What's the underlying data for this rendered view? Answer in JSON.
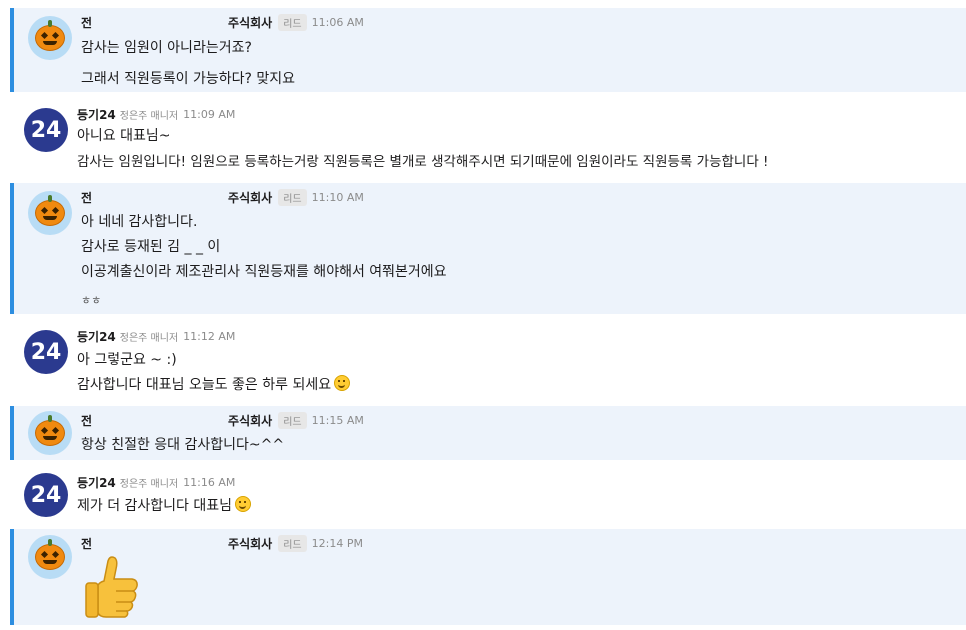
{
  "colors": {
    "highlight_bg": "#edf3fb",
    "highlight_border": "#2d8ee0",
    "brand_avatar": "#2b3a8f"
  },
  "messages": [
    {
      "sender": "전",
      "company": "주식회사",
      "tag": "리드",
      "time": "11:06 AM",
      "avatar": "pumpkin-icon",
      "lines": [
        "감사는 임원이 아니라는거죠?",
        "그래서 직원등록이 가능하다? 맞지요"
      ]
    },
    {
      "sender": "등기24",
      "subtitle": "정은주 매니저",
      "time": "11:09 AM",
      "avatar_text": "24",
      "lines": [
        "아니요 대표님~",
        "감사는 임원입니다! 임원으로 등록하는거랑 직원등록은 별개로 생각해주시면 되기때문에 임원이라도 직원등록 가능합니다 !"
      ]
    },
    {
      "sender": "전",
      "company": "주식회사",
      "tag": "리드",
      "time": "11:10 AM",
      "avatar": "pumpkin-icon",
      "lines": [
        "아 네네 감사합니다.",
        "감사로 등재된 김  _ _ 이",
        "이공계출신이라 제조관리사 직원등재를 해야해서 여쭤본거에요",
        "ㅎㅎ"
      ]
    },
    {
      "sender": "등기24",
      "subtitle": "정은주 매니저",
      "time": "11:12 AM",
      "avatar_text": "24",
      "lines": [
        "아 그렇군요 ~ :)",
        "감사합니다 대표님 오늘도 좋은 하루 되세요"
      ]
    },
    {
      "sender": "전",
      "company": "주식회사",
      "tag": "리드",
      "time": "11:15 AM",
      "avatar": "pumpkin-icon",
      "lines": [
        "항상 친절한 응대 감사합니다~^^"
      ]
    },
    {
      "sender": "등기24",
      "subtitle": "정은주 매니저",
      "time": "11:16 AM",
      "avatar_text": "24",
      "lines": [
        "제가 더 감사합니다 대표님"
      ]
    },
    {
      "sender": "전",
      "company": "주식회사",
      "tag": "리드",
      "time": "12:14 PM",
      "avatar": "pumpkin-icon",
      "emoji": "thumbs-up-icon"
    }
  ]
}
